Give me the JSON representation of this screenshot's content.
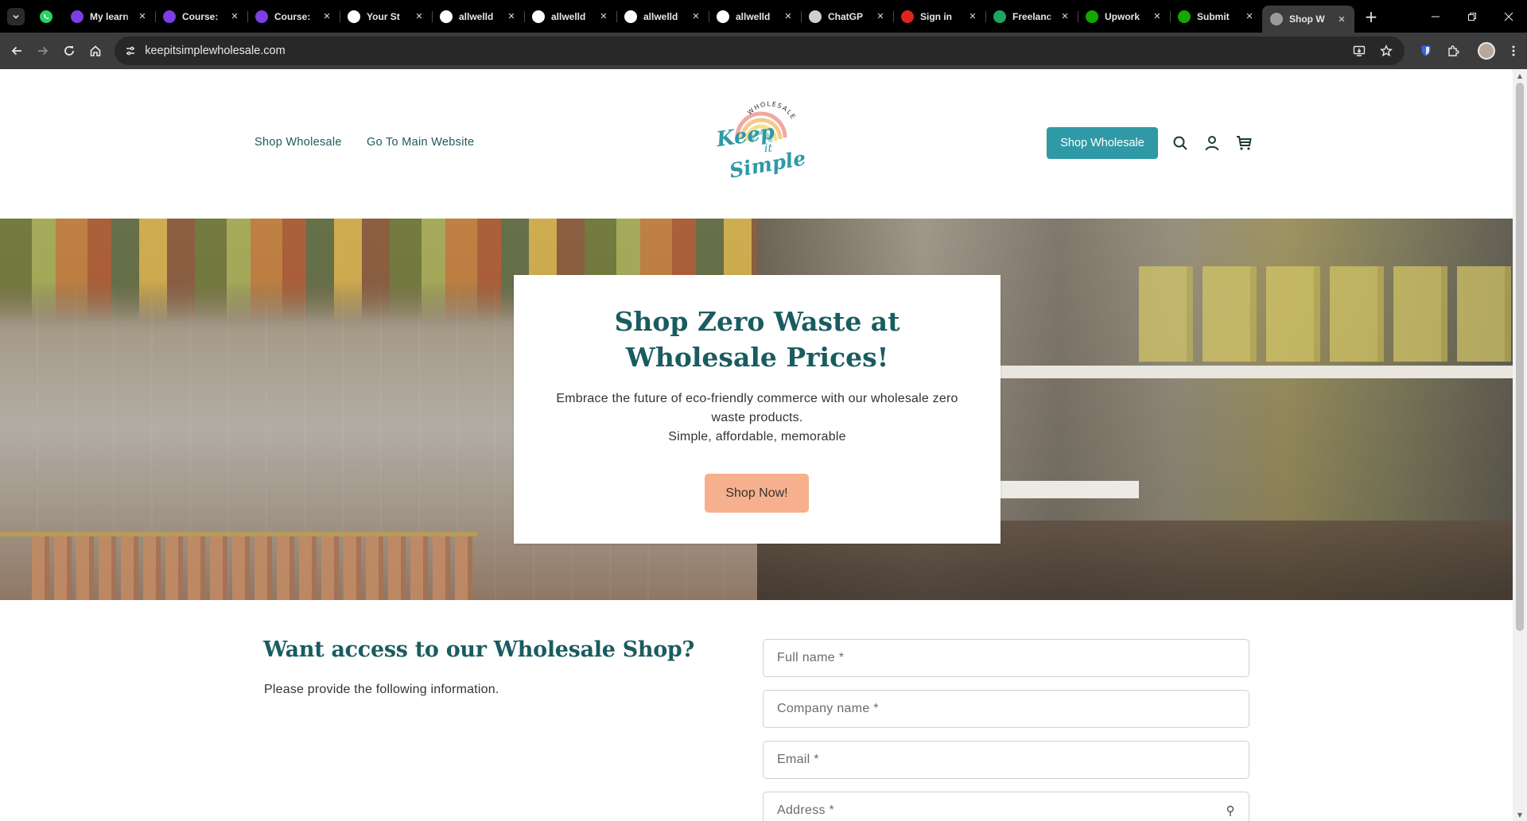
{
  "browser": {
    "tabs": [
      {
        "title": "My learn",
        "favicon_color": "#7b3fe4"
      },
      {
        "title": "Course:",
        "favicon_color": "#7b3fe4"
      },
      {
        "title": "Course:",
        "favicon_color": "#7b3fe4"
      },
      {
        "title": "Your St",
        "favicon_color": "#ffffff"
      },
      {
        "title": "allwelld",
        "favicon_color": "#ffffff"
      },
      {
        "title": "allwelld",
        "favicon_color": "#ffffff"
      },
      {
        "title": "allwelld",
        "favicon_color": "#ffffff"
      },
      {
        "title": "allwelld",
        "favicon_color": "#ffffff"
      },
      {
        "title": "ChatGP",
        "favicon_color": "#cfcfcf"
      },
      {
        "title": "Sign in",
        "favicon_color": "#e0241b"
      },
      {
        "title": "Freelanc",
        "favicon_color": "#1fa463"
      },
      {
        "title": "Upwork",
        "favicon_color": "#14a800"
      },
      {
        "title": "Submit",
        "favicon_color": "#14a800"
      },
      {
        "title": "Shop W",
        "favicon_color": "#9a9a9a"
      }
    ],
    "url": "keepitsimplewholesale.com"
  },
  "header": {
    "nav": [
      {
        "label": "Shop Wholesale"
      },
      {
        "label": "Go To Main Website"
      }
    ],
    "logo": {
      "top_text": "WHOLESALE",
      "line1": "Keep",
      "line2": "it",
      "line3": "Simple"
    },
    "cta_label": "Shop Wholesale"
  },
  "hero": {
    "title": "Shop Zero Waste at Wholesale Prices!",
    "subtitle_line1": "Embrace the future of eco-friendly commerce with our wholesale zero waste products.",
    "subtitle_line2": "Simple, affordable, memorable",
    "cta_label": "Shop Now!"
  },
  "access": {
    "title": "Want access to our Wholesale Shop?",
    "subtitle": "Please provide the following information."
  },
  "form": {
    "full_name_placeholder": "Full name *",
    "company_placeholder": "Company name *",
    "email_placeholder": "Email *",
    "address_placeholder": "Address *"
  },
  "colors": {
    "brand_teal": "#1a5c60",
    "button_teal": "#2f99a6",
    "cta_peach": "#f7b08d"
  }
}
